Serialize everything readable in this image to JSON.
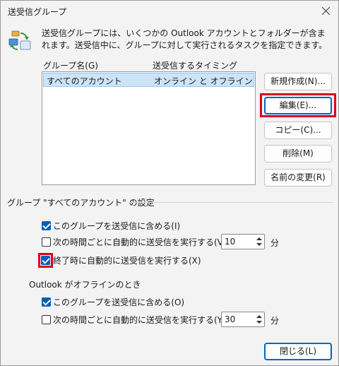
{
  "window": {
    "title": "送受信グループ"
  },
  "description": {
    "text": "送受信グループには、いくつかの Outlook アカウントとフォルダーが含まれます。送受信中に、グループに対して実行されるタスクを指定できます。"
  },
  "list": {
    "headers": [
      "グループ名(G)",
      "送受信するタイミング"
    ],
    "rows": [
      {
        "name": "すべてのアカウント",
        "timing": "オンライン と オフライン",
        "selected": true
      }
    ]
  },
  "buttons": {
    "new": "新規作成(N)...",
    "edit": "編集(E)...",
    "copy": "コピー(C)...",
    "delete": "削除(M)",
    "rename": "名前の変更(R)",
    "close": "閉じる(L)"
  },
  "group_settings": {
    "title": "グループ \"すべてのアカウント\" の設定",
    "include_online": {
      "label": "このグループを送受信に含める(I)",
      "checked": true
    },
    "auto_online": {
      "label": "次の時間ごとに自動的に送受信を実行する(V)",
      "checked": false,
      "value": "10",
      "unit": "分"
    },
    "on_exit": {
      "label": "終了時に自動的に送受信を実行する(X)",
      "checked": true
    }
  },
  "offline_settings": {
    "title": "Outlook がオフラインのとき",
    "include_offline": {
      "label": "このグループを送受信に含める(O)",
      "checked": true
    },
    "auto_offline": {
      "label": "次の時間ごとに自動的に送受信を実行する(Y)",
      "checked": false,
      "value": "30",
      "unit": "分"
    }
  },
  "colors": {
    "accent": "#005fb8",
    "selection": "#cce4f7",
    "highlight": "#e0001b"
  }
}
